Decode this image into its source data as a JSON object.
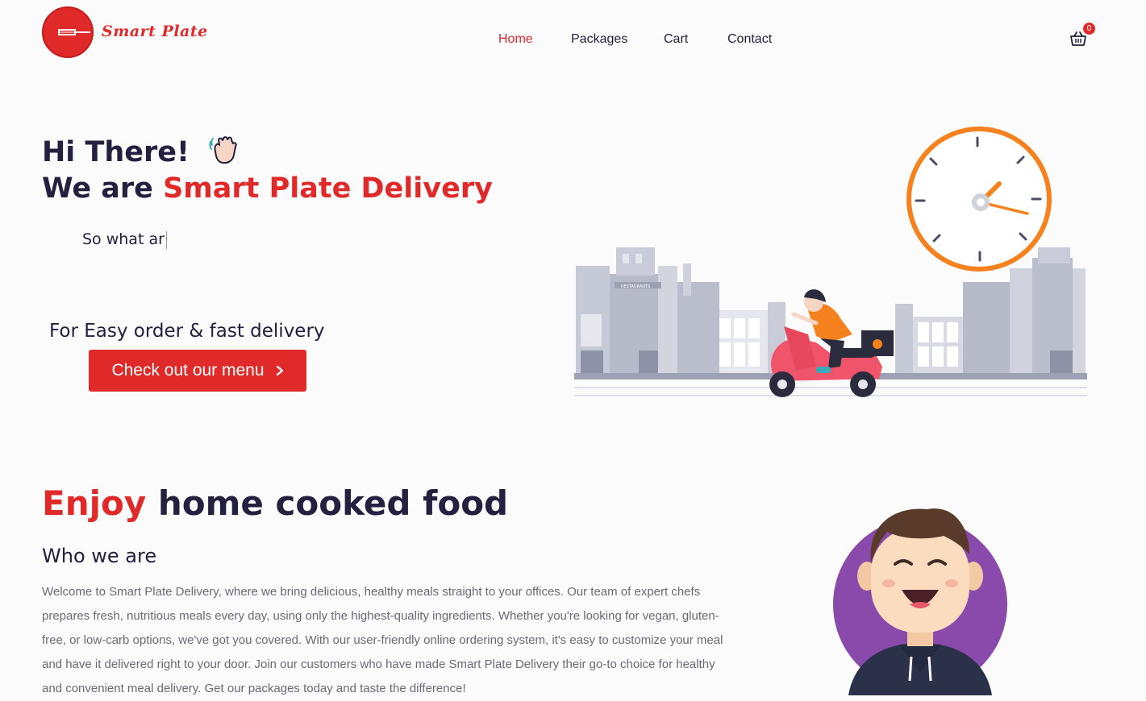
{
  "brand": {
    "name": "Smart Plate",
    "accent_color": "#e02a2a",
    "text_color": "#23213f"
  },
  "nav": [
    {
      "label": "Home",
      "active": true
    },
    {
      "label": "Packages",
      "active": false
    },
    {
      "label": "Cart",
      "active": false
    },
    {
      "label": "Contact",
      "active": false
    }
  ],
  "cart": {
    "icon": "basket-icon",
    "count": "0"
  },
  "hero": {
    "greeting": "Hi There!",
    "greeting_icon": "waving-hand-icon",
    "headline_prefix": "We are ",
    "headline_brand": "Smart Plate Delivery",
    "typing_text": "So what ar",
    "tagline": "For Easy order & fast delivery",
    "cta_label": "Check out our menu",
    "cta_icon": "chevron-right-icon"
  },
  "about": {
    "title_highlight": "Enjoy",
    "title_rest": " home cooked food",
    "subtitle": "Who we are",
    "body": "Welcome to Smart Plate Delivery, where we bring delicious, healthy meals straight to your offices. Our team of expert chefs prepares fresh, nutritious meals every day, using only the highest-quality ingredients. Whether you're looking for vegan, gluten-free, or low-carb options, we've got you covered. With our user-friendly online ordering system, it's easy to customize your meal and have it delivered right to your door. Join our customers who have made Smart Plate Delivery their go-to choice for healthy and convenient meal delivery. Get our packages today and taste the difference!"
  }
}
